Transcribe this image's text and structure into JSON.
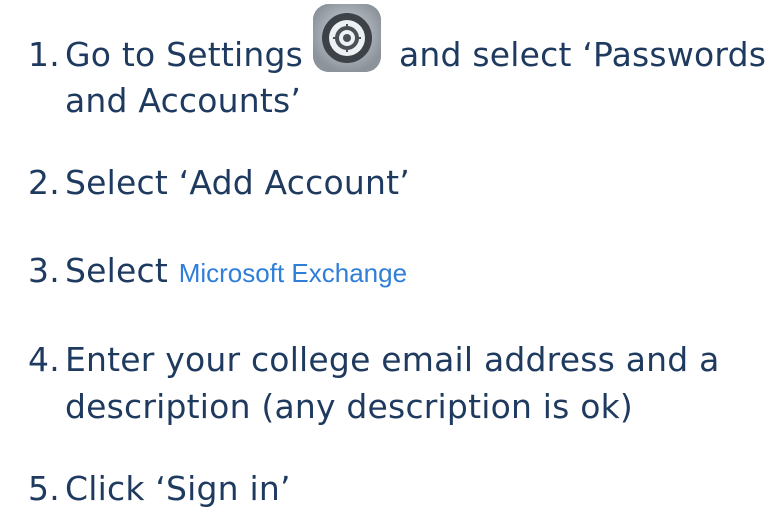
{
  "steps": [
    {
      "number": "1.",
      "text_before_icon": "Go to Settings",
      "icon": "settings-gear-icon",
      "text_after_icon": "and select ‘Passwords",
      "continuation": "and Accounts’"
    },
    {
      "number": "2.",
      "text": "Select ‘Add Account’"
    },
    {
      "number": "3.",
      "text": "Select",
      "highlight": "Microsoft Exchange"
    },
    {
      "number": "4.",
      "line1": "Enter your college email address and a",
      "line2": "description (any description is ok)"
    },
    {
      "number": "5.",
      "text": "Click ‘Sign in’"
    }
  ],
  "colors": {
    "text": "#1f3a5f",
    "highlight": "#2f7ed8",
    "icon_background": "#7b8189"
  }
}
